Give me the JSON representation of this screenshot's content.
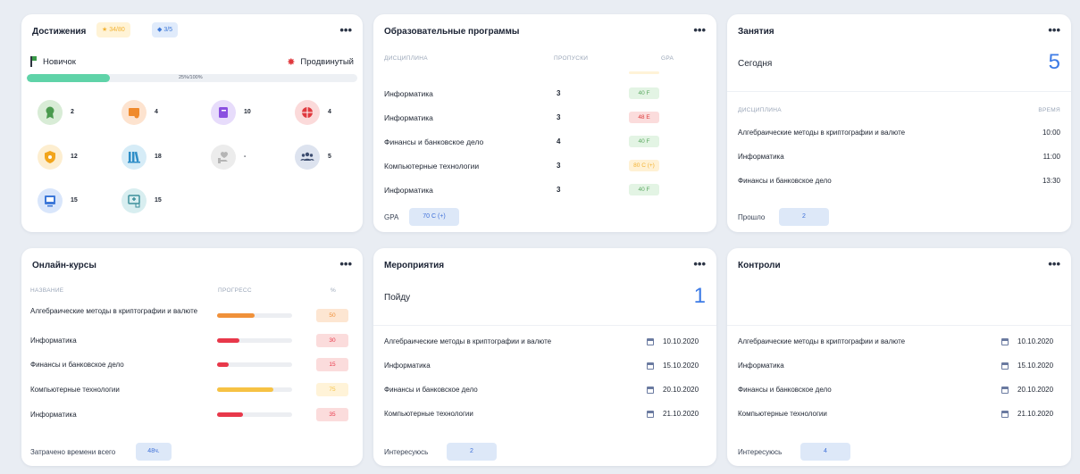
{
  "achievements": {
    "title": "Достижения",
    "badge_coins": "34/80",
    "badge_gems": "3/5",
    "level_from": "Новичок",
    "level_to": "Продвинутый",
    "progress_label": "25%/100%",
    "progress": 0.25,
    "items": [
      {
        "icon": "ribbon-award-icon",
        "count": "2",
        "color": "#d8ecd6",
        "fg": "#4a9a4e"
      },
      {
        "icon": "certificate-icon",
        "count": "4",
        "color": "#fde3cf",
        "fg": "#f08a2c"
      },
      {
        "icon": "notebook-icon",
        "count": "10",
        "color": "#e7dcfb",
        "fg": "#8a4fe0"
      },
      {
        "icon": "basketball-icon",
        "count": "4",
        "color": "#fbdada",
        "fg": "#e0393e"
      },
      {
        "icon": "shield-star-icon",
        "count": "12",
        "color": "#fdeed0",
        "fg": "#f2a51c"
      },
      {
        "icon": "books-icon",
        "count": "18",
        "color": "#d6ecf7",
        "fg": "#2d8dc7"
      },
      {
        "icon": "heart-hand-icon",
        "count": "-",
        "color": "#ececec",
        "fg": "#b5b5b5"
      },
      {
        "icon": "group-icon",
        "count": "5",
        "color": "#dde3ef",
        "fg": "#3d4d70"
      },
      {
        "icon": "presentation-icon",
        "count": "15",
        "color": "#d9e6fb",
        "fg": "#3d78d8"
      },
      {
        "icon": "board-icon",
        "count": "15",
        "color": "#d8eef0",
        "fg": "#3c8f9a"
      }
    ]
  },
  "programs": {
    "title": "Образовательные программы",
    "col_discipline": "ДИСЦИПЛИНА",
    "col_absences": "ПРОПУСКИ",
    "col_gpa": "GPA",
    "rows": [
      {
        "name": "Информатика",
        "absences": "3",
        "gpa": "40 F",
        "bg": "#e3f4e4",
        "fg": "#5aa860"
      },
      {
        "name": "Информатика",
        "absences": "3",
        "gpa": "48 E",
        "bg": "#fbdcdc",
        "fg": "#dc3c3c"
      },
      {
        "name": "Финансы и банковское дело",
        "absences": "4",
        "gpa": "40 F",
        "bg": "#e3f4e4",
        "fg": "#5aa860"
      },
      {
        "name": "Компьютерные технологии",
        "absences": "3",
        "gpa": "80 C (+)",
        "bg": "#fff1d4",
        "fg": "#f2b233"
      },
      {
        "name": "Информатика",
        "absences": "3",
        "gpa": "40 F",
        "bg": "#e3f4e4",
        "fg": "#5aa860"
      }
    ],
    "footer_label": "GPA",
    "footer_value": "70 C (+)"
  },
  "classes": {
    "title": "Занятия",
    "today_label": "Сегодня",
    "today_count": "5",
    "col_discipline": "ДИСЦИПЛИНА",
    "col_time": "ВРЕМЯ",
    "rows": [
      {
        "name": "Алгебраические методы в криптографии и валюте",
        "time": "10:00"
      },
      {
        "name": "Информатика",
        "time": "11:00"
      },
      {
        "name": "Финансы и банковское дело",
        "time": "13:30"
      }
    ],
    "footer_label": "Прошло",
    "footer_value": "2"
  },
  "courses": {
    "title": "Онлайн-курсы",
    "col_name": "НАЗВАНИЕ",
    "col_progress": "ПРОГРЕСС",
    "col_percent": "%",
    "rows": [
      {
        "name": "Алгебраические методы в криптографии и валюте",
        "percent": "50",
        "value": 0.5,
        "bar": "#f0913a",
        "bg": "#fde6d2",
        "fg": "#f0913a"
      },
      {
        "name": "Информатика",
        "percent": "30",
        "value": 0.3,
        "bar": "#e8384a",
        "bg": "#fbdcdc",
        "fg": "#e8384a"
      },
      {
        "name": "Финансы и банковское дело",
        "percent": "15",
        "value": 0.15,
        "bar": "#e8384a",
        "bg": "#fbdcdc",
        "fg": "#e8384a"
      },
      {
        "name": "Компьютерные технологии",
        "percent": "75",
        "value": 0.75,
        "bar": "#f6c244",
        "bg": "#fff3d8",
        "fg": "#f6c244"
      },
      {
        "name": "Информатика",
        "percent": "35",
        "value": 0.35,
        "bar": "#e8384a",
        "bg": "#fbdcdc",
        "fg": "#e8384a"
      }
    ],
    "footer_label": "Затрачено времени всего",
    "footer_value": "48ч."
  },
  "events": {
    "title": "Мероприятия",
    "going_label": "Пойду",
    "going_count": "1",
    "rows": [
      {
        "name": "Алгебраические методы в криптографии и валюте",
        "date": "10.10.2020"
      },
      {
        "name": "Информатика",
        "date": "15.10.2020"
      },
      {
        "name": "Финансы и банковское дело",
        "date": "20.10.2020"
      },
      {
        "name": "Компьютерные технологии",
        "date": "21.10.2020"
      }
    ],
    "footer_label": "Интересуюсь",
    "footer_value": "2"
  },
  "controls": {
    "title": "Контроли",
    "rows": [
      {
        "name": "Алгебраические методы в криптографии и валюте",
        "date": "10.10.2020"
      },
      {
        "name": "Информатика",
        "date": "15.10.2020"
      },
      {
        "name": "Финансы и банковское дело",
        "date": "20.10.2020"
      },
      {
        "name": "Компьютерные технологии",
        "date": "21.10.2020"
      }
    ],
    "footer_label": "Интересуюсь",
    "footer_value": "4"
  },
  "menu_dots": "•••"
}
